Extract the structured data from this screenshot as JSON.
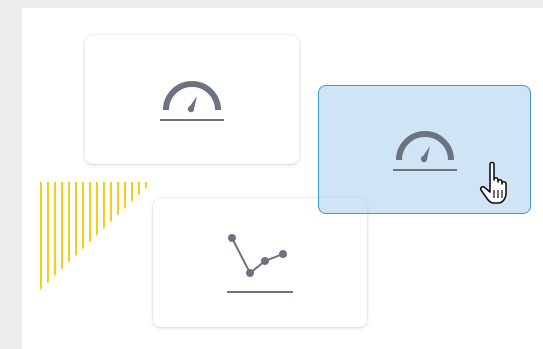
{
  "canvas": {
    "background": "#ffffff",
    "page_background": "#eeedeb"
  },
  "widgets": [
    {
      "icon": "gauge-icon",
      "state": "default"
    },
    {
      "icon": "line-chart-icon",
      "state": "default"
    },
    {
      "icon": "gauge-icon",
      "state": "dragging"
    }
  ],
  "colors": {
    "icon": "#6b7280",
    "drag_fill": "#b1d4ee",
    "drag_border": "#3e9bd6",
    "hatch": "#f2cf1d"
  },
  "cursor": {
    "icon": "hand-pointer-icon"
  }
}
